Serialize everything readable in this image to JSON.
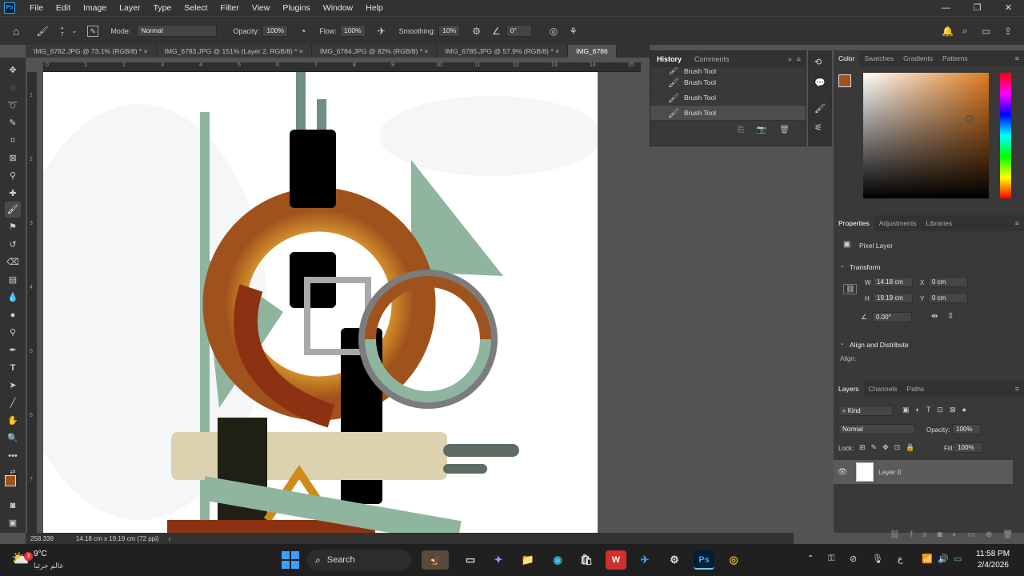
{
  "menubar": {
    "logo": "Ps",
    "items": [
      "File",
      "Edit",
      "Image",
      "Layer",
      "Type",
      "Select",
      "Filter",
      "View",
      "Plugins",
      "Window",
      "Help"
    ],
    "minimize": "—",
    "restore": "❐",
    "close": "✕"
  },
  "options": {
    "brush_size": "7",
    "mode_label": "Mode:",
    "mode_value": "Normal",
    "opacity_label": "Opacity:",
    "opacity_value": "100%",
    "flow_label": "Flow:",
    "flow_value": "100%",
    "smoothing_label": "Smoothing:",
    "smoothing_value": "10%",
    "angle_value": "0°"
  },
  "tabs": [
    {
      "label": "IMG_6782.JPG @ 73.1% (RGB/8) *"
    },
    {
      "label": "IMG_6783.JPG @ 151% (Layer 2, RGB/8) *"
    },
    {
      "label": "IMG_6784.JPG @ 82% (RGB/8) *"
    },
    {
      "label": "IMG_6785.JPG @ 57.9% (RGB/8) *"
    },
    {
      "label": "IMG_6786"
    }
  ],
  "ruler": {
    "h": [
      "0",
      "1",
      "2",
      "3",
      "4",
      "5",
      "6",
      "7",
      "8",
      "9",
      "10",
      "11",
      "12",
      "13",
      "14",
      "15"
    ],
    "v": [
      "1",
      "2",
      "3",
      "4",
      "5",
      "6",
      "7"
    ]
  },
  "history": {
    "tab_history": "History",
    "tab_comments": "Comments",
    "items": [
      "Brush Tool",
      "Brush Tool",
      "Brush Tool",
      "Brush Tool"
    ]
  },
  "color_panel": {
    "tabs": [
      "Color",
      "Swatches",
      "Gradients",
      "Patterns"
    ],
    "fg": "#a0521c",
    "hue": "#e07b20"
  },
  "properties": {
    "tabs": [
      "Properties",
      "Adjustments",
      "Libraries"
    ],
    "layer_type": "Pixel Layer",
    "transform": "Transform",
    "w_label": "W",
    "w": "14.18 cm",
    "x_label": "X",
    "x": "0 cm",
    "h_label": "H",
    "h": "19.19 cm",
    "y_label": "Y",
    "y": "0 cm",
    "angle": "0.00°",
    "align": "Align and Distribute",
    "align_sub": "Align:"
  },
  "layers": {
    "tabs": [
      "Layers",
      "Channels",
      "Paths"
    ],
    "kind": "Kind",
    "blend": "Normal",
    "opacity_label": "Opacity:",
    "opacity": "100%",
    "lock_label": "Lock:",
    "fill_label": "Fill:",
    "fill": "100%",
    "layer_name": "Layer 0"
  },
  "status": {
    "coords": "258.339",
    "doc_info": "14.18 cm x 19.19 cm (72 ppi)"
  },
  "taskbar": {
    "weather_temp": "9°C",
    "weather_desc": "عالم جرئيا",
    "weather_badge": "3",
    "search_placeholder": "Search",
    "lang": "ع",
    "time": "11:58 PM",
    "date": "2/4/2026"
  }
}
